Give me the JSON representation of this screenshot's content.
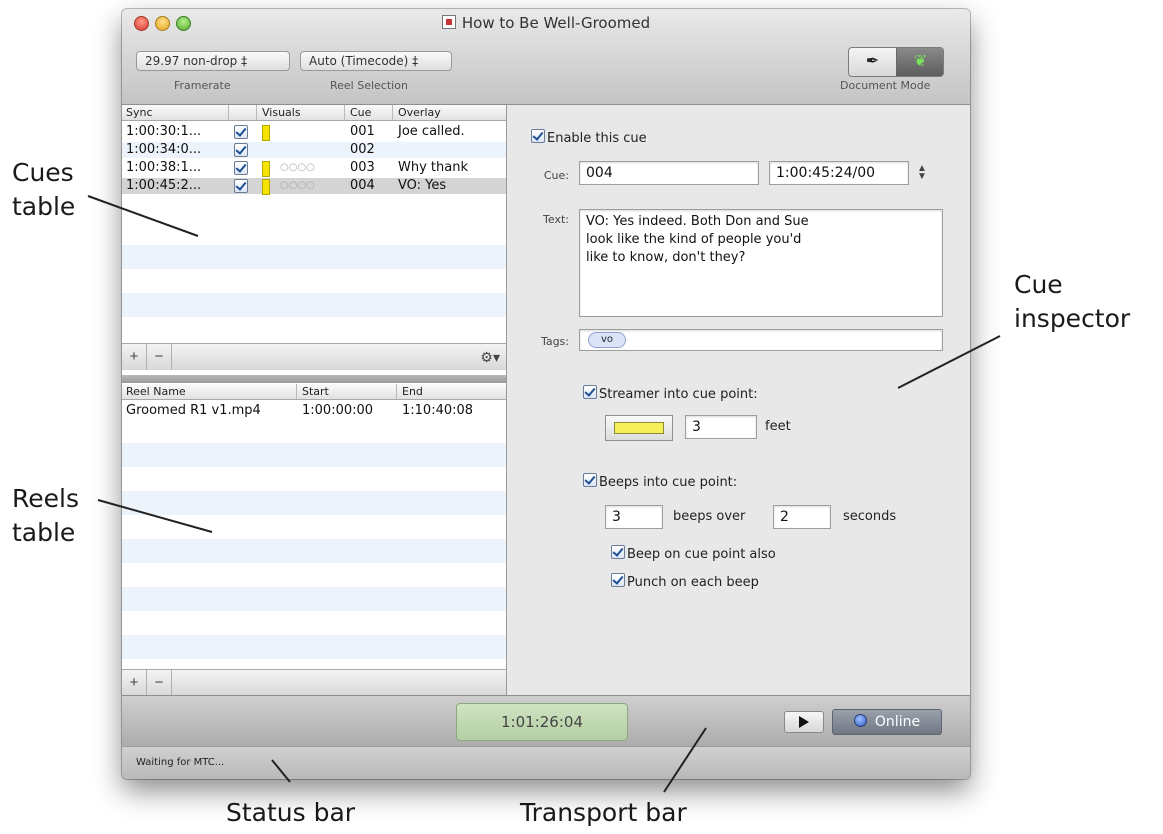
{
  "window": {
    "title": "How to Be Well-Groomed"
  },
  "toolbar": {
    "framerate_value": "29.97 non-drop ‡",
    "framerate_label": "Framerate",
    "reel_value": "Auto (Timecode) ‡",
    "reel_label": "Reel Selection",
    "document_mode_label": "Document Mode",
    "mode_icons": [
      "pin-icon",
      "leaf-icon"
    ]
  },
  "cues_table": {
    "columns": [
      "Sync",
      "Visuals",
      "Cue",
      "Overlay"
    ],
    "rows": [
      {
        "sync": "1:00:30:1...",
        "enabled": true,
        "has_streamer": true,
        "has_beeps": false,
        "cue": "001",
        "overlay": "Joe called."
      },
      {
        "sync": "1:00:34:0...",
        "enabled": true,
        "has_streamer": false,
        "has_beeps": false,
        "cue": "002",
        "overlay": ""
      },
      {
        "sync": "1:00:38:1...",
        "enabled": true,
        "has_streamer": true,
        "has_beeps": true,
        "cue": "003",
        "overlay": "Why thank"
      },
      {
        "sync": "1:00:45:2...",
        "enabled": true,
        "has_streamer": true,
        "has_beeps": true,
        "cue": "004",
        "overlay": "VO: Yes"
      }
    ],
    "selected_index": 3,
    "add_label": "+",
    "remove_label": "−",
    "gear_label": "⚙▾"
  },
  "reels_table": {
    "columns": [
      "Reel Name",
      "Start",
      "End"
    ],
    "rows": [
      {
        "name": "Groomed R1 v1.mp4",
        "start": "1:00:00:00",
        "end": "1:10:40:08"
      }
    ],
    "add_label": "+",
    "remove_label": "−"
  },
  "inspector": {
    "enable_label": "Enable this cue",
    "enable_checked": true,
    "cue_label": "Cue:",
    "cue_value": "004",
    "timecode_value": "1:00:45:24/00",
    "text_label": "Text:",
    "text_value": "VO: Yes indeed. Both Don and Sue\nlook like the kind of people you'd\nlike to know, don't they?",
    "tags_label": "Tags:",
    "tags": [
      "vo"
    ],
    "streamer_label": "Streamer into cue point:",
    "streamer_checked": true,
    "streamer_color": "#f5f05a",
    "streamer_length": "3",
    "streamer_unit": "feet",
    "beeps_label": "Beeps into cue point:",
    "beeps_checked": true,
    "beeps_count": "3",
    "beeps_over_label": "beeps over",
    "beeps_seconds": "2",
    "beeps_seconds_label": "seconds",
    "beep_on_cue_label": "Beep on cue point also",
    "beep_on_cue_checked": true,
    "punch_label": "Punch on each beep",
    "punch_checked": true
  },
  "transport": {
    "timecode": "1:01:26:04",
    "online_label": "Online"
  },
  "status": {
    "text": "Waiting for MTC..."
  },
  "callouts": {
    "cues_table": "Cues\ntable",
    "reels_table": "Reels\ntable",
    "cue_inspector": "Cue\ninspector",
    "status_bar": "Status bar",
    "transport_bar": "Transport bar"
  },
  "colors": {
    "streamer_yellow": "#f5e400",
    "timecode_green": "#c2dab4",
    "selection_gray": "#d4d4d4",
    "stripe_blue": "#edf3fb"
  }
}
